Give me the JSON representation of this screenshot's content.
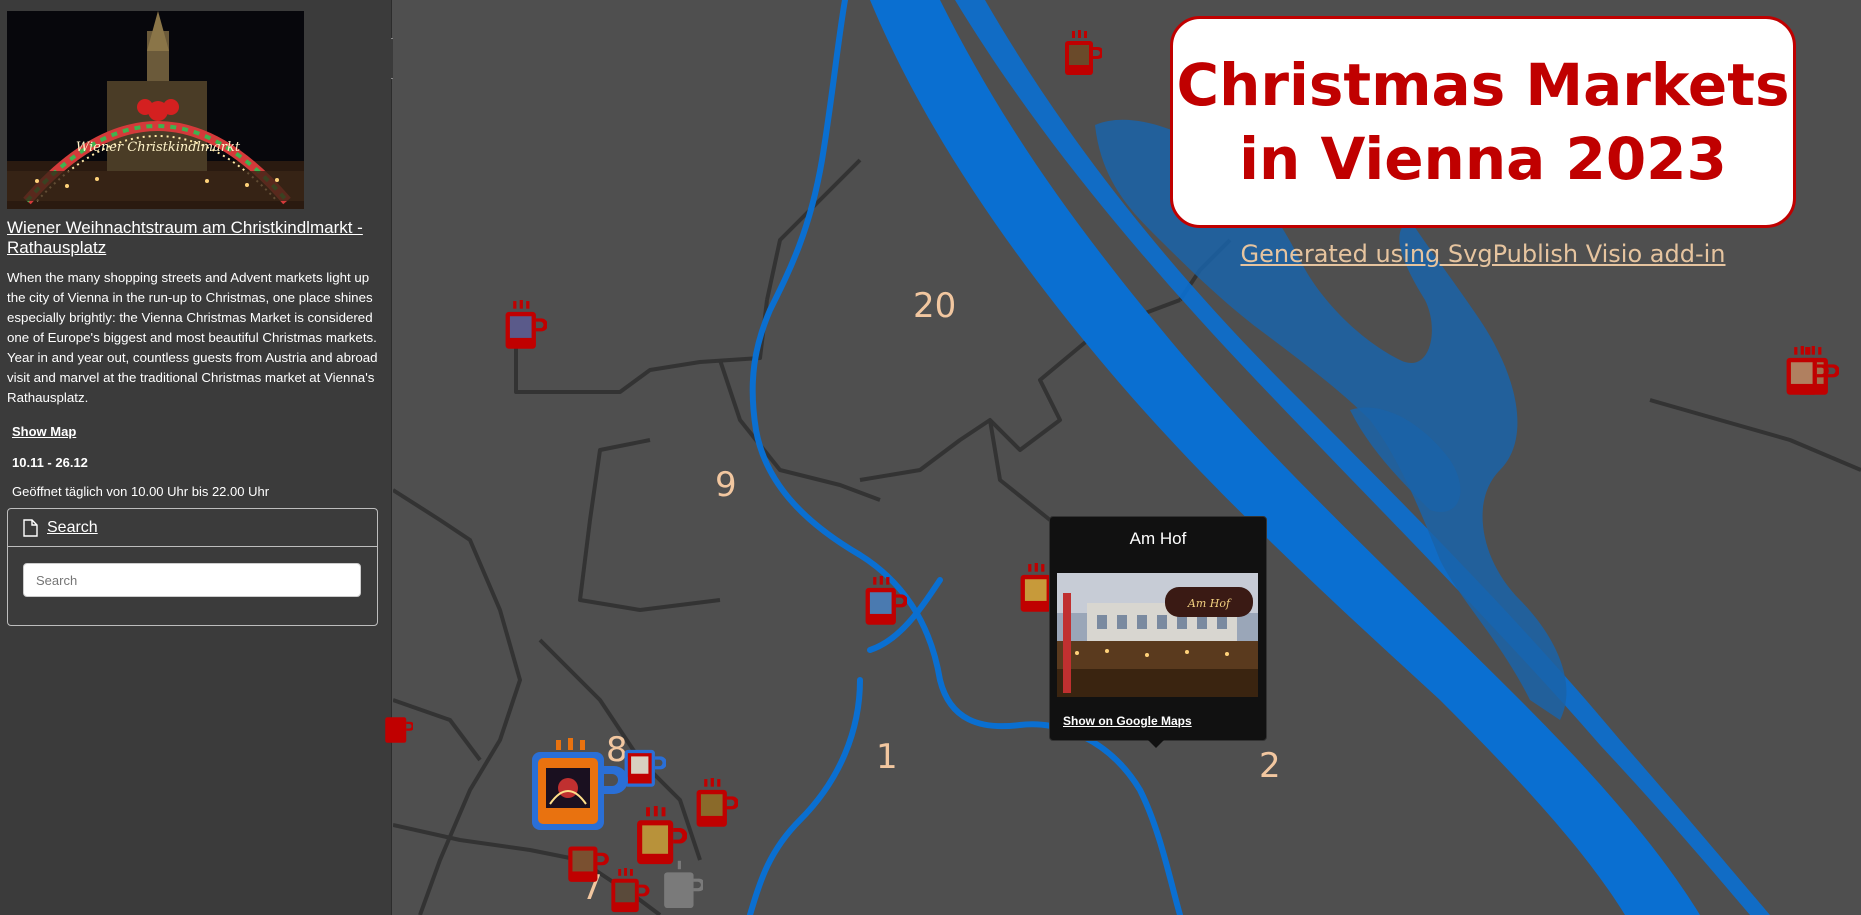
{
  "sidebar": {
    "market_title": "Wiener Weihnachtstraum am Christkindlmarkt - Rathausplatz",
    "description": "When the many shopping streets and Advent markets light up the city of Vienna in the run-up to Christmas, one place shines especially brightly: the Vienna Christmas Market is considered one of Europe's biggest and most beautiful Christmas markets. Year in and year out, countless guests from Austria and abroad visit and marvel at the traditional Christmas market at Vienna's Rathausplatz.",
    "show_map_label": "Show Map",
    "dates": "10.11 - 26.12",
    "hours": "Geöffnet täglich von 10.00 Uhr bis 22.00 Uhr",
    "hero_sign_text": "Wiener Christkindlmarkt",
    "search": {
      "title": "Search",
      "placeholder": "Search",
      "value": ""
    }
  },
  "map": {
    "title": "Christmas Markets in Vienna 2023",
    "generated_link": "Generated using SvgPublish Visio add-in",
    "districts": [
      "20",
      "9",
      "8",
      "1",
      "2",
      "7"
    ],
    "popup": {
      "title": "Am Hof",
      "link": "Show on Google Maps",
      "photo_sign_text": "Am Hof"
    }
  },
  "colors": {
    "sidebar_bg": "#3b3b3b",
    "map_bg": "#4f4f4f",
    "river": "#0a6fd1",
    "accent_red": "#c00000",
    "district_label": "#f2c7a0",
    "highlight_orange": "#e9720f"
  },
  "icons": {
    "toggle": "columns-icon",
    "search_header": "document-icon",
    "marker": "mug-icon"
  }
}
